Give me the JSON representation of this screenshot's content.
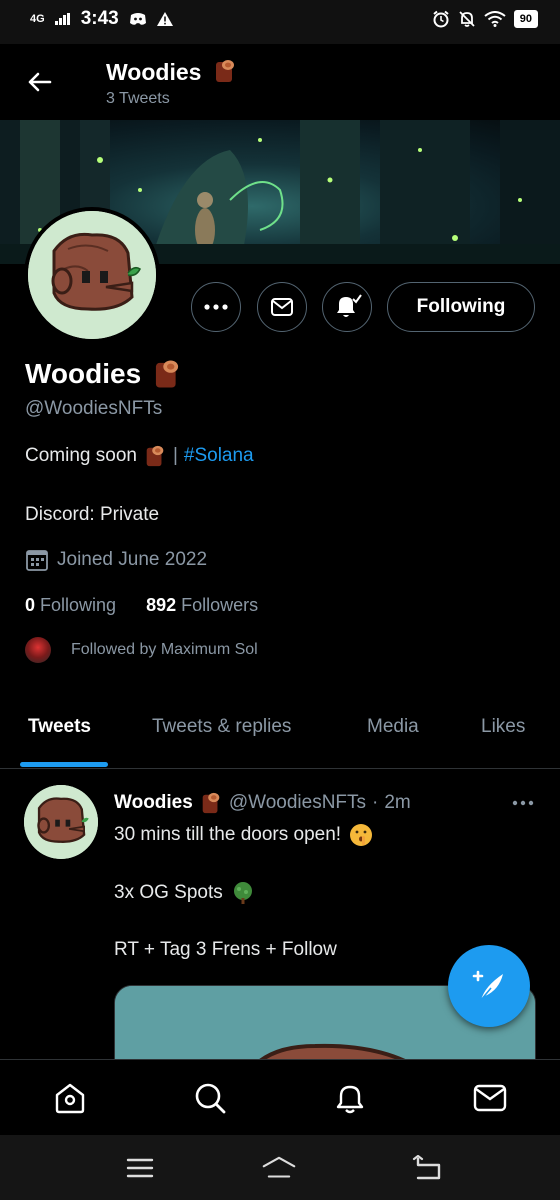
{
  "status_bar": {
    "network": "4G",
    "time": "3:43",
    "battery": "90",
    "icons": [
      "discord-icon",
      "warning-icon",
      "alarm-icon",
      "mute-icon",
      "wifi-icon",
      "battery-icon"
    ]
  },
  "header": {
    "title": "Woodies",
    "tweet_count": "3 Tweets"
  },
  "profile": {
    "name": "Woodies",
    "handle": "@WoodiesNFTs",
    "bio_text": "Coming soon",
    "bio_separator": "|",
    "bio_hashtag": "#Solana",
    "discord": "Discord: Private",
    "joined": "Joined June 2022",
    "following_count": "0",
    "following_label": "Following",
    "followers_count": "892",
    "followers_label": "Followers",
    "followed_by": "Followed by Maximum Sol",
    "follow_button": "Following"
  },
  "tabs": [
    {
      "label": "Tweets",
      "active": true
    },
    {
      "label": "Tweets & replies",
      "active": false
    },
    {
      "label": "Media",
      "active": false
    },
    {
      "label": "Likes",
      "active": false
    }
  ],
  "tweet": {
    "author": "Woodies",
    "handle": "@WoodiesNFTs",
    "separator": "·",
    "time": "2m",
    "line1": "30 mins till the doors open!",
    "line2": "3x OG Spots",
    "line3": "RT + Tag 3 Frens + Follow"
  },
  "colors": {
    "accent": "#1d9bf0",
    "background": "#000000",
    "muted_text": "#8b98a5",
    "avatar_bg": "#cfe9cf"
  }
}
